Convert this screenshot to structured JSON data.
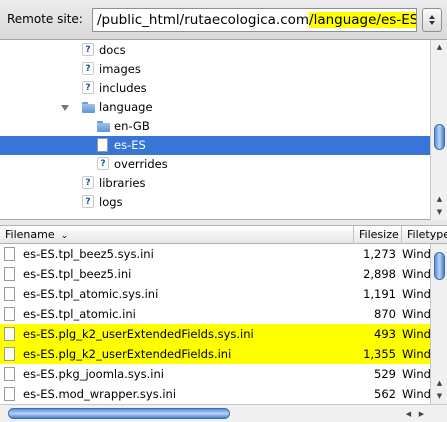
{
  "remote_site": {
    "label": "Remote site:",
    "path_prefix": "/public_html/rutaecologica.com",
    "path_highlight": "/language/es-ES",
    "highlight_color": "#ffff00"
  },
  "tree": {
    "items": [
      {
        "label": "docs",
        "icon": "unknown-folder-icon",
        "selected": false
      },
      {
        "label": "images",
        "icon": "unknown-folder-icon",
        "selected": false
      },
      {
        "label": "includes",
        "icon": "unknown-folder-icon",
        "selected": false
      },
      {
        "label": "language",
        "icon": "folder-icon",
        "selected": false,
        "expanded": true
      },
      {
        "label": "en-GB",
        "icon": "folder-icon",
        "selected": false
      },
      {
        "label": "es-ES",
        "icon": "page-icon",
        "selected": true
      },
      {
        "label": "overrides",
        "icon": "unknown-folder-icon",
        "selected": false
      },
      {
        "label": "libraries",
        "icon": "unknown-folder-icon",
        "selected": false
      },
      {
        "label": "logs",
        "icon": "unknown-folder-icon",
        "selected": false
      }
    ],
    "selection_color": "#3875d7"
  },
  "file_list": {
    "columns": {
      "filename": "Filename",
      "filesize": "Filesize",
      "filetype": "Filetype"
    },
    "rows": [
      {
        "name": "es-ES.tpl_beez5.sys.ini",
        "size": "1,273",
        "type": "Wind",
        "highlighted": false
      },
      {
        "name": "es-ES.tpl_beez5.ini",
        "size": "2,898",
        "type": "Wind",
        "highlighted": false
      },
      {
        "name": "es-ES.tpl_atomic.sys.ini",
        "size": "1,191",
        "type": "Wind",
        "highlighted": false
      },
      {
        "name": "es-ES.tpl_atomic.ini",
        "size": "870",
        "type": "Wind",
        "highlighted": false
      },
      {
        "name": "es-ES.plg_k2_userExtendedFields.sys.ini",
        "size": "493",
        "type": "Wind",
        "highlighted": true
      },
      {
        "name": "es-ES.plg_k2_userExtendedFields.ini",
        "size": "1,355",
        "type": "Wind",
        "highlighted": true
      },
      {
        "name": "es-ES.pkg_joomla.sys.ini",
        "size": "529",
        "type": "Wind",
        "highlighted": false
      },
      {
        "name": "es-ES.mod_wrapper.sys.ini",
        "size": "562",
        "type": "Wind",
        "highlighted": false
      }
    ],
    "highlight_color": "#ffff00"
  }
}
